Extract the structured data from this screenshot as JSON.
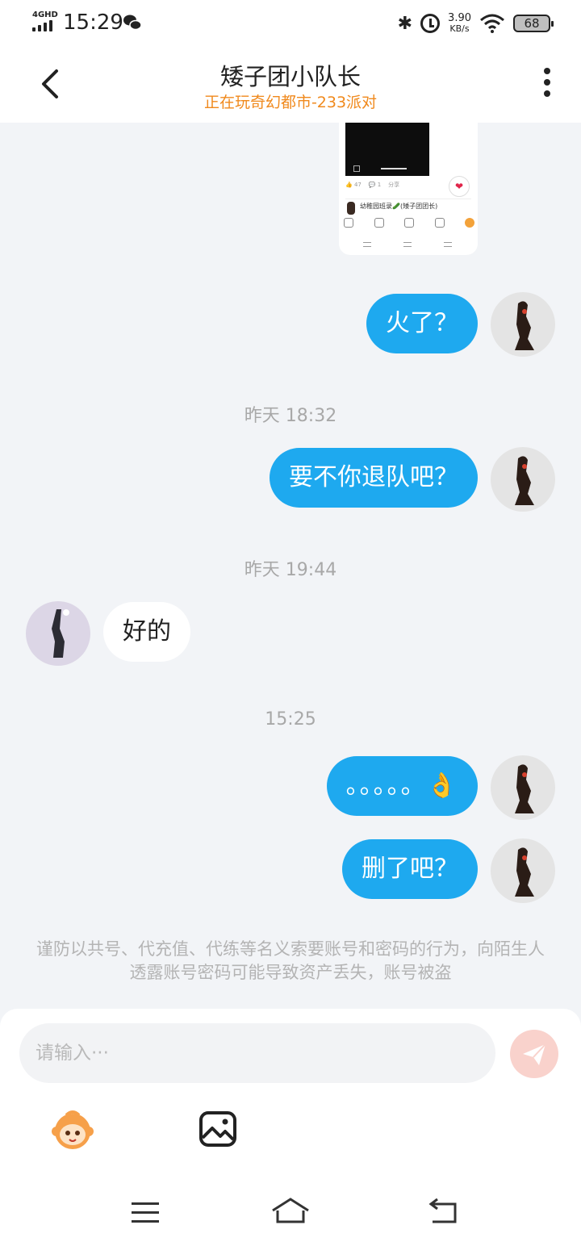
{
  "status_bar": {
    "network": "4GHD",
    "time": "15:29",
    "speed_value": "3.90",
    "speed_unit": "KB/s",
    "battery": "68"
  },
  "header": {
    "title": "矮子团小队长",
    "subtitle": "正在玩奇幻都市-233派对"
  },
  "shared_image": {
    "likes": "47",
    "comments": "1",
    "share": "分享",
    "username": "幼稚园班录🥒(矮子团团长)"
  },
  "messages": [
    {
      "text": "火了？"
    },
    {
      "time": "昨天 18:32"
    },
    {
      "text": "要不你退队吧？"
    },
    {
      "time": "昨天 19:44"
    },
    {
      "text": "好的"
    },
    {
      "time": "15:25"
    },
    {
      "text": "。。。。。👌"
    },
    {
      "text": "删了吧？"
    }
  ],
  "warning": "谨防以共号、代充值、代练等名义索要账号和密码的行为，向陌生人透露账号密码可能导致资产丢失，账号被盗",
  "composer": {
    "placeholder": "请输入···"
  },
  "colors": {
    "accent": "#1ea9ef",
    "subtitle": "#f0891c",
    "send_disabled": "#f9d2cc"
  }
}
